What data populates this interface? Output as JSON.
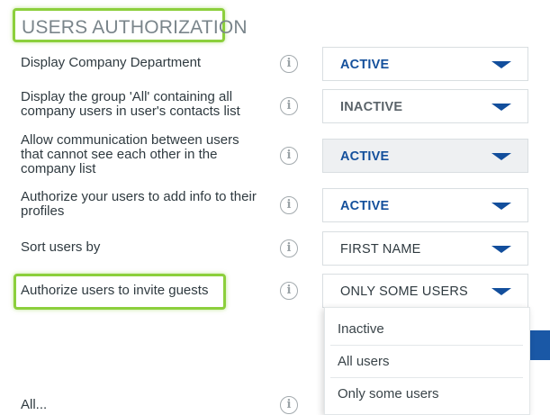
{
  "section": {
    "title": "USERS AUTHORIZATION"
  },
  "rows": [
    {
      "label": "Display Company Department",
      "value": "ACTIVE"
    },
    {
      "label": "Display the group 'All' containing all company users in user's contacts list",
      "value": "INACTIVE"
    },
    {
      "label": "Allow communication between users that cannot see each other in the company list",
      "value": "ACTIVE"
    },
    {
      "label": "Authorize your users to add info to their profiles",
      "value": "ACTIVE"
    },
    {
      "label": "Sort users by",
      "value": "FIRST NAME"
    },
    {
      "label": "Authorize users to invite guests",
      "value": "ONLY SOME USERS"
    }
  ],
  "dropdown": {
    "options": [
      "Inactive",
      "All users",
      "Only some users"
    ]
  },
  "partial_row": {
    "label": "All..."
  },
  "icons": {
    "info": "info-icon",
    "chevron": "chevron-down-icon"
  },
  "colors": {
    "highlight": "#8ccf3c",
    "accent": "#14509c"
  }
}
